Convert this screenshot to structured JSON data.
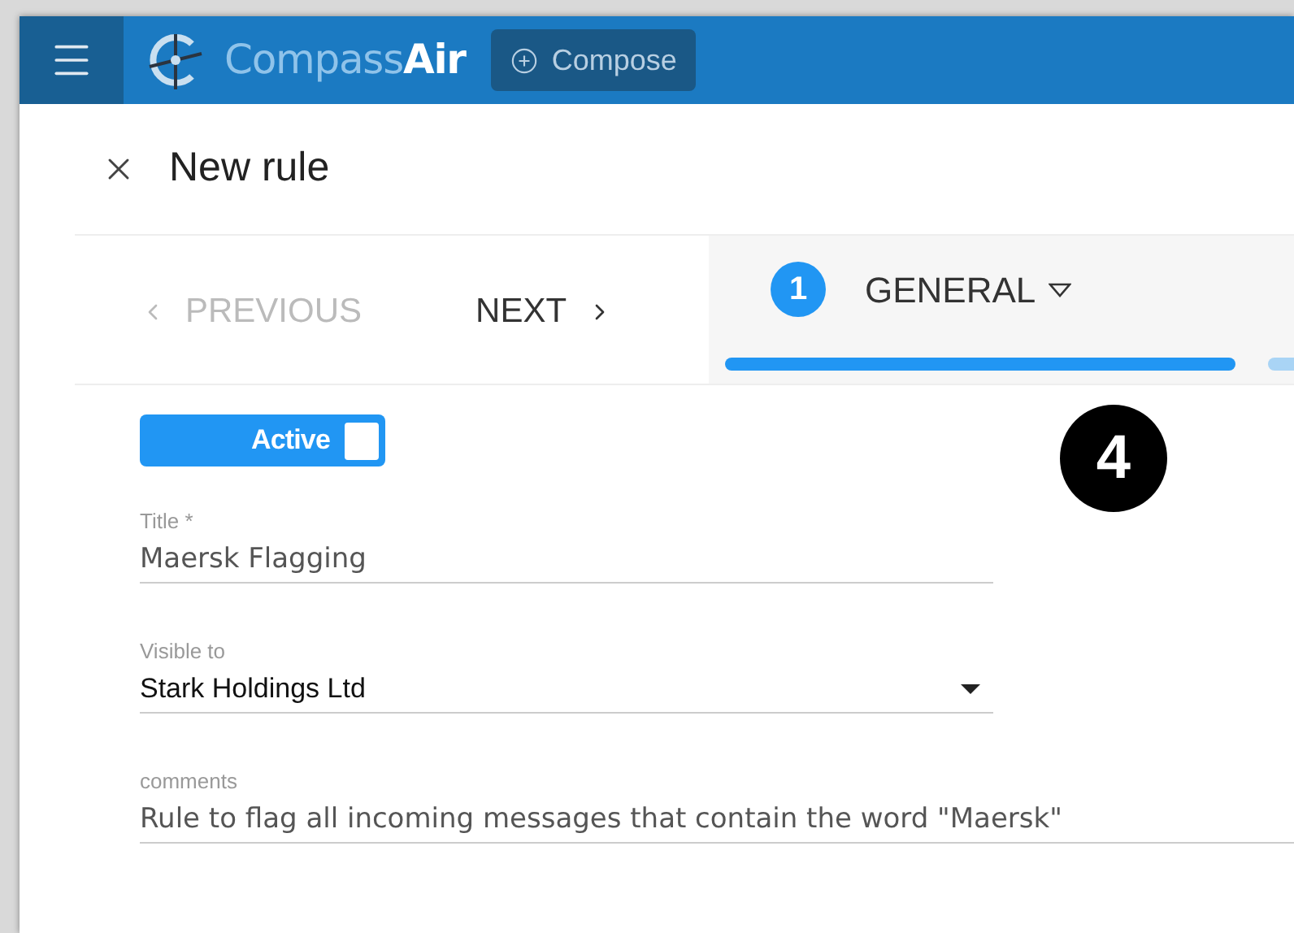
{
  "app": {
    "brand_light": "Compass",
    "brand_bold": "Air",
    "compose_button": "Compose"
  },
  "dialog": {
    "title": "New rule"
  },
  "stepper": {
    "previous": {
      "label": "PREVIOUS",
      "disabled": true
    },
    "next": {
      "label": "NEXT",
      "disabled": false
    },
    "steps": [
      {
        "number": "1",
        "label": "GENERAL",
        "selected": true
      },
      {
        "selected": false
      }
    ]
  },
  "active_toggle": {
    "label": "Active",
    "on": true
  },
  "fields": [
    {
      "kind": "text",
      "label": "Title *",
      "value": "Maersk Flagging"
    },
    {
      "kind": "select",
      "label": "Visible to",
      "value": "Stark Holdings Ltd"
    },
    {
      "kind": "wide",
      "label": "comments",
      "value": "Rule to flag all incoming messages that contain the word \"Maersk\""
    }
  ],
  "callout": "4"
}
